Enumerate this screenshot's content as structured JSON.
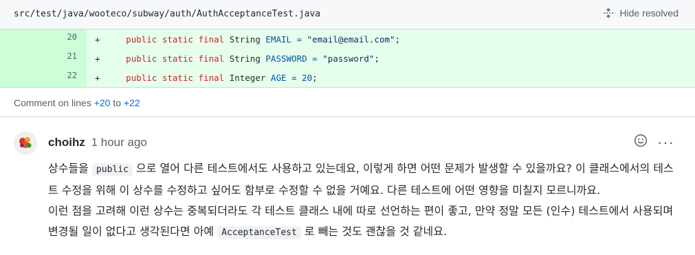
{
  "file": {
    "path": "src/test/java/wooteco/subway/auth/AuthAcceptanceTest.java",
    "hide_resolved_label": "Hide resolved",
    "hide_resolved_icon": "unfold-icon"
  },
  "diff": {
    "rows": [
      {
        "line": "20",
        "marker": "+",
        "kw": "public static final",
        "type": "String",
        "name": "EMAIL",
        "eq": "=",
        "value": "\"email@email.com\"",
        "end": ";"
      },
      {
        "line": "21",
        "marker": "+",
        "kw": "public static final",
        "type": "String",
        "name": "PASSWORD",
        "eq": "=",
        "value": "\"password\"",
        "end": ";"
      },
      {
        "line": "22",
        "marker": "+",
        "kw": "public static final",
        "type": "Integer",
        "name": "AGE",
        "eq": "=",
        "value": "20",
        "end": ";"
      }
    ]
  },
  "comment_lines": {
    "prefix": "Comment on lines",
    "from": "+20",
    "to_word": "to",
    "to": "+22"
  },
  "comment": {
    "author": "choihz",
    "time": "1 hour ago",
    "p1_a": "상수들을 ",
    "p1_code": "public",
    "p1_b": " 으로 열어 다른 테스트에서도 사용하고 있는데요, 이렇게 하면 어떤 문제가 발생할 수 있을까요? 이 클래스에서의 테스트 수정을 위해 이 상수를 수정하고 싶어도 함부로 수정할 수 없을 거예요. 다른 테스트에 어떤 영향을 미칠지 모르니까요.",
    "p2_a": "이런 점을 고려해 이런 상수는 중복되더라도 각 테스트 클래스 내에 따로 선언하는 편이 좋고, 만약 정말 모든 (인수) 테스트에서 사용되며 변경될 일이 없다고 생각된다면 아예 ",
    "p2_code": "AcceptanceTest",
    "p2_b": " 로 빼는 것도 괜찮을 것 같네요.",
    "more_label": "···"
  }
}
